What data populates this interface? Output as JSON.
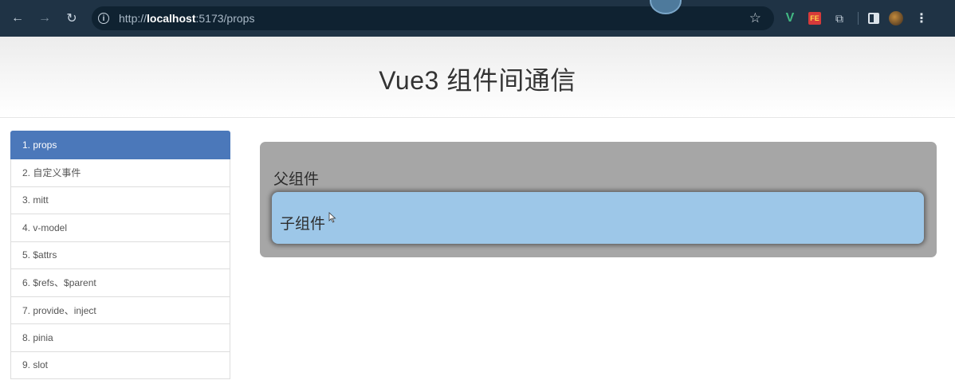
{
  "browser": {
    "url_prefix": "http://",
    "url_host": "localhost",
    "url_rest": ":5173/props",
    "icons": {
      "back": "back-arrow-icon",
      "forward": "forward-arrow-icon",
      "reload": "reload-icon",
      "info": "site-info-icon",
      "bookmark": "star-icon"
    },
    "extensions": {
      "vue_label": "V",
      "fe_label": "FE"
    }
  },
  "header": {
    "title": "Vue3 组件间通信"
  },
  "sidebar": {
    "items": [
      {
        "label": "1. props",
        "active": true
      },
      {
        "label": "2. 自定义事件",
        "active": false
      },
      {
        "label": "3. mitt",
        "active": false
      },
      {
        "label": "4. v-model",
        "active": false
      },
      {
        "label": "5. $attrs",
        "active": false
      },
      {
        "label": "6. $refs、$parent",
        "active": false
      },
      {
        "label": "7. provide、inject",
        "active": false
      },
      {
        "label": "8. pinia",
        "active": false
      },
      {
        "label": "9. slot",
        "active": false
      }
    ]
  },
  "main": {
    "parent_label": "父组件",
    "child_label": "子组件"
  },
  "colors": {
    "chrome": "#1f3345",
    "active_nav": "#4b78ba",
    "parent_bg": "#a6a6a6",
    "child_bg": "#9dc7e8"
  }
}
